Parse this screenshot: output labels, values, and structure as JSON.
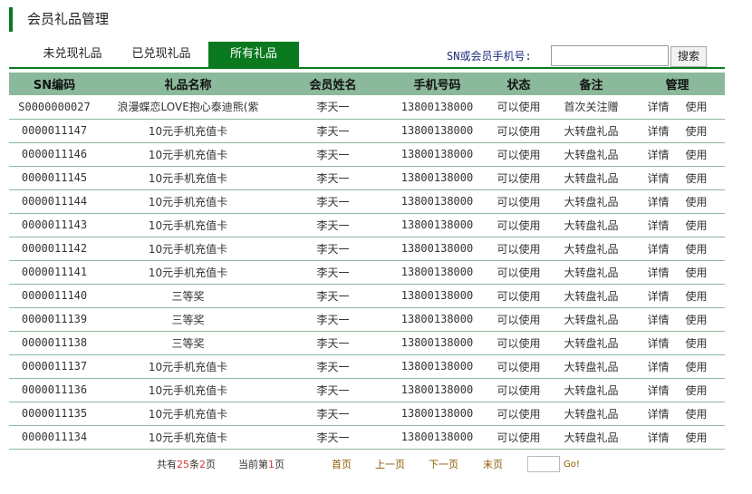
{
  "page": {
    "title": "会员礼品管理"
  },
  "tabs": [
    {
      "label": "未兑现礼品",
      "active": false
    },
    {
      "label": "已兑现礼品",
      "active": false
    },
    {
      "label": "所有礼品",
      "active": true
    }
  ],
  "search": {
    "label": "SN或会员手机号:",
    "value": "",
    "button_label": "搜索"
  },
  "columns": [
    "SN编码",
    "礼品名称",
    "会员姓名",
    "手机号码",
    "状态",
    "备注",
    "管理"
  ],
  "actions": {
    "detail": "详情",
    "use": "使用"
  },
  "rows": [
    {
      "sn": "S0000000027",
      "gift": "浪漫蝶恋LOVE抱心泰迪熊(紫",
      "member": "李天一",
      "phone": "13800138000",
      "status": "可以使用",
      "remark": "首次关注赠"
    },
    {
      "sn": "0000011147",
      "gift": "10元手机充值卡",
      "member": "李天一",
      "phone": "13800138000",
      "status": "可以使用",
      "remark": "大转盘礼品"
    },
    {
      "sn": "0000011146",
      "gift": "10元手机充值卡",
      "member": "李天一",
      "phone": "13800138000",
      "status": "可以使用",
      "remark": "大转盘礼品"
    },
    {
      "sn": "0000011145",
      "gift": "10元手机充值卡",
      "member": "李天一",
      "phone": "13800138000",
      "status": "可以使用",
      "remark": "大转盘礼品"
    },
    {
      "sn": "0000011144",
      "gift": "10元手机充值卡",
      "member": "李天一",
      "phone": "13800138000",
      "status": "可以使用",
      "remark": "大转盘礼品"
    },
    {
      "sn": "0000011143",
      "gift": "10元手机充值卡",
      "member": "李天一",
      "phone": "13800138000",
      "status": "可以使用",
      "remark": "大转盘礼品"
    },
    {
      "sn": "0000011142",
      "gift": "10元手机充值卡",
      "member": "李天一",
      "phone": "13800138000",
      "status": "可以使用",
      "remark": "大转盘礼品"
    },
    {
      "sn": "0000011141",
      "gift": "10元手机充值卡",
      "member": "李天一",
      "phone": "13800138000",
      "status": "可以使用",
      "remark": "大转盘礼品"
    },
    {
      "sn": "0000011140",
      "gift": "三等奖",
      "member": "李天一",
      "phone": "13800138000",
      "status": "可以使用",
      "remark": "大转盘礼品"
    },
    {
      "sn": "0000011139",
      "gift": "三等奖",
      "member": "李天一",
      "phone": "13800138000",
      "status": "可以使用",
      "remark": "大转盘礼品"
    },
    {
      "sn": "0000011138",
      "gift": "三等奖",
      "member": "李天一",
      "phone": "13800138000",
      "status": "可以使用",
      "remark": "大转盘礼品"
    },
    {
      "sn": "0000011137",
      "gift": "10元手机充值卡",
      "member": "李天一",
      "phone": "13800138000",
      "status": "可以使用",
      "remark": "大转盘礼品"
    },
    {
      "sn": "0000011136",
      "gift": "10元手机充值卡",
      "member": "李天一",
      "phone": "13800138000",
      "status": "可以使用",
      "remark": "大转盘礼品"
    },
    {
      "sn": "0000011135",
      "gift": "10元手机充值卡",
      "member": "李天一",
      "phone": "13800138000",
      "status": "可以使用",
      "remark": "大转盘礼品"
    },
    {
      "sn": "0000011134",
      "gift": "10元手机充值卡",
      "member": "李天一",
      "phone": "13800138000",
      "status": "可以使用",
      "remark": "大转盘礼品"
    }
  ],
  "pager": {
    "total_prefix": "共有",
    "total_records": "25",
    "total_mid": "条",
    "total_pages": "2",
    "total_suffix": "页",
    "current_prefix": "当前第",
    "current_page": "1",
    "current_suffix": "页",
    "first": "首页",
    "prev": "上一页",
    "next": "下一页",
    "last": "末页",
    "go": "Go!"
  },
  "colors": {
    "accent": "#0b7a1e",
    "header_bg": "#8bb99b"
  }
}
